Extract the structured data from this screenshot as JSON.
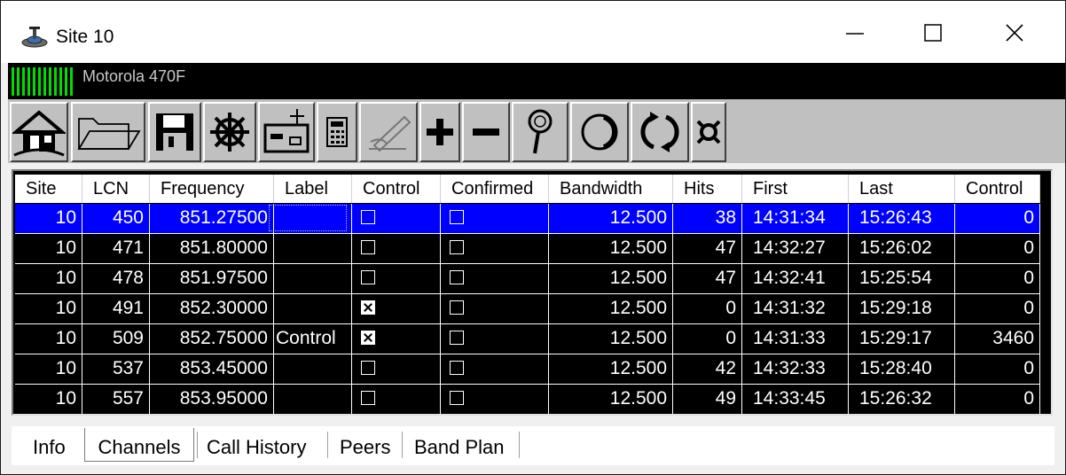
{
  "window": {
    "title": "Site 10"
  },
  "device": {
    "name": "Motorola 470F"
  },
  "toolbar": {
    "items": [
      "home-icon",
      "folder-open-icon",
      "save-disk-icon",
      "ship-wheel-icon",
      "radio-icon",
      "calculator-icon",
      "edit-pen-icon",
      "plus-icon",
      "minus-icon",
      "search-icon",
      "circle-icon",
      "refresh-arrows-icon",
      "currency-icon"
    ]
  },
  "table": {
    "columns": [
      "Site",
      "LCN",
      "Frequency",
      "Label",
      "Control",
      "Confirmed",
      "Bandwidth",
      "Hits",
      "First",
      "Last",
      "Control"
    ],
    "rows": [
      {
        "site": "10",
        "lcn": "450",
        "frequency": "851.27500",
        "label": "",
        "control": false,
        "confirmed": false,
        "bandwidth": "12.500",
        "hits": "38",
        "first": "14:31:34",
        "last": "15:26:43",
        "control_count": "0",
        "selected": true
      },
      {
        "site": "10",
        "lcn": "471",
        "frequency": "851.80000",
        "label": "",
        "control": false,
        "confirmed": false,
        "bandwidth": "12.500",
        "hits": "47",
        "first": "14:32:27",
        "last": "15:26:02",
        "control_count": "0"
      },
      {
        "site": "10",
        "lcn": "478",
        "frequency": "851.97500",
        "label": "",
        "control": false,
        "confirmed": false,
        "bandwidth": "12.500",
        "hits": "47",
        "first": "14:32:41",
        "last": "15:25:54",
        "control_count": "0"
      },
      {
        "site": "10",
        "lcn": "491",
        "frequency": "852.30000",
        "label": "",
        "control": true,
        "confirmed": false,
        "bandwidth": "12.500",
        "hits": "0",
        "first": "14:31:32",
        "last": "15:29:18",
        "control_count": "0"
      },
      {
        "site": "10",
        "lcn": "509",
        "frequency": "852.75000",
        "label": "Control",
        "control": true,
        "confirmed": false,
        "bandwidth": "12.500",
        "hits": "0",
        "first": "14:31:33",
        "last": "15:29:17",
        "control_count": "3460"
      },
      {
        "site": "10",
        "lcn": "537",
        "frequency": "853.45000",
        "label": "",
        "control": false,
        "confirmed": false,
        "bandwidth": "12.500",
        "hits": "42",
        "first": "14:32:33",
        "last": "15:28:40",
        "control_count": "0"
      },
      {
        "site": "10",
        "lcn": "557",
        "frequency": "853.95000",
        "label": "",
        "control": false,
        "confirmed": false,
        "bandwidth": "12.500",
        "hits": "49",
        "first": "14:33:45",
        "last": "15:26:32",
        "control_count": "0"
      }
    ]
  },
  "tabs": [
    {
      "label": "Info"
    },
    {
      "label": "Channels",
      "active": true
    },
    {
      "label": "Call History"
    },
    {
      "label": "Peers"
    },
    {
      "label": "Band Plan"
    }
  ],
  "colors": {
    "selection": "#0000ff",
    "grid_bg": "#000000",
    "signal": "#00dd00"
  }
}
